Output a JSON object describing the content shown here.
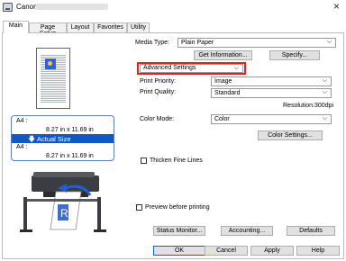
{
  "window": {
    "title": "Canon"
  },
  "tabs": [
    "Main",
    "Page Setup",
    "Layout",
    "Favorites",
    "Utility"
  ],
  "left": {
    "size1_label": "A4 :",
    "size1_value": "8.27 in x 11.69 in",
    "actual_size": "Actual Size",
    "size2_label": "A4 :",
    "size2_value": "8.27 in x 11.69 in"
  },
  "media_type": {
    "label": "Media Type:",
    "value": "Plain Paper"
  },
  "buttons": {
    "get_information": "Get Information...",
    "specify": "Specify...",
    "color_settings": "Color Settings...",
    "status_monitor": "Status Monitor...",
    "accounting": "Accounting...",
    "defaults": "Defaults",
    "ok": "OK",
    "cancel": "Cancel",
    "apply": "Apply",
    "help": "Help"
  },
  "advanced_settings": {
    "value": "Advanced Settings"
  },
  "print_priority": {
    "label": "Print Priority:",
    "value": "Image"
  },
  "print_quality": {
    "label": "Print Quality:",
    "value": "Standard",
    "resolution": "Resolution:300dpi"
  },
  "color_mode": {
    "label": "Color Mode:",
    "value": "Color"
  },
  "thicken_fine_lines": {
    "label": "Thicken Fine Lines",
    "checked": false
  },
  "preview_before_printing": {
    "label": "Preview before printing",
    "checked": false
  },
  "colors": {
    "accent": "#0d59c8",
    "highlight_border": "#e0201b"
  }
}
